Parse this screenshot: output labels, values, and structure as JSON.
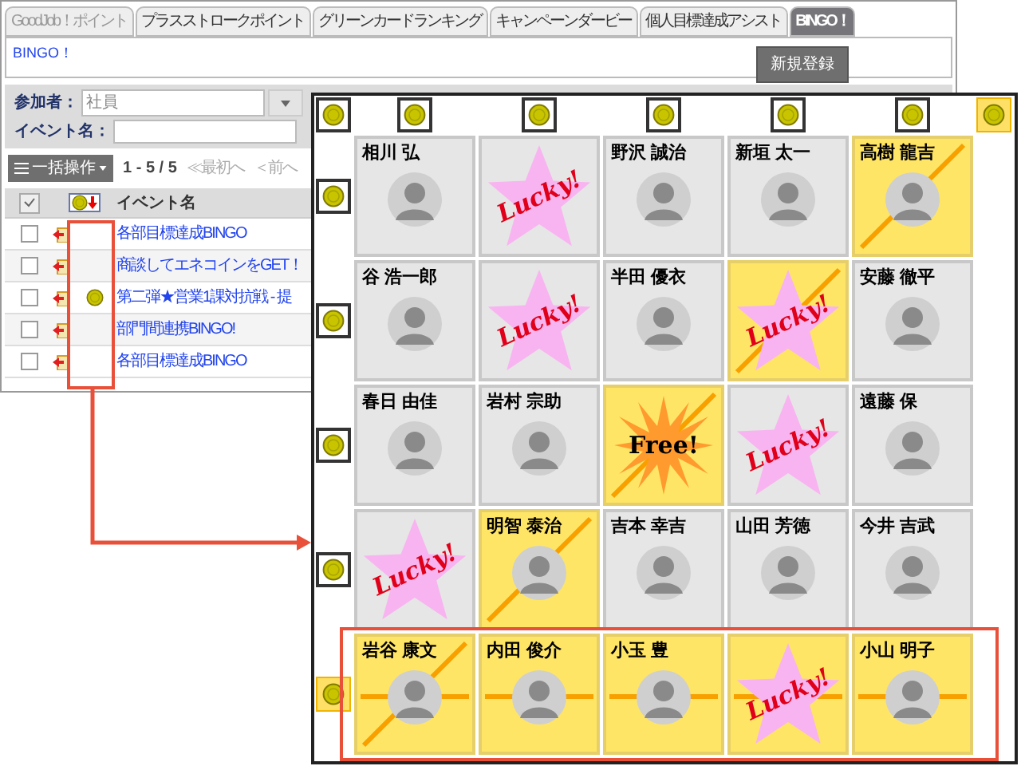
{
  "tabs": [
    {
      "label": "GoodJob！ポイント",
      "selected": false,
      "disabled": true
    },
    {
      "label": "プラスストロークポイント",
      "selected": false,
      "disabled": false
    },
    {
      "label": "グリーンカードランキング",
      "selected": false,
      "disabled": false
    },
    {
      "label": "キャンペーンダービー",
      "selected": false,
      "disabled": false
    },
    {
      "label": "個人目標達成アシスト",
      "selected": false,
      "disabled": false
    },
    {
      "label": "BINGO！",
      "selected": true,
      "disabled": false
    }
  ],
  "page_title": "BINGO！",
  "new_button": "新規登録",
  "filters": {
    "participant_label": "参加者：",
    "participant_value": "社員",
    "event_label": "イベント名："
  },
  "toolbar": {
    "bulk_button": "一括操作",
    "range": "1 - 5 / 5",
    "first": "≪最初へ",
    "prev": "＜前へ"
  },
  "table": {
    "column_title": "イベント名",
    "rows": [
      {
        "checked": false,
        "has_coin": false,
        "title": "各部目標達成BINGO"
      },
      {
        "checked": false,
        "has_coin": false,
        "title": "商談してエネコインをGET！"
      },
      {
        "checked": false,
        "has_coin": true,
        "title": "第二弾★営業1課対抗戦 - 提"
      },
      {
        "checked": false,
        "has_coin": false,
        "title": "部門間連携BINGO!"
      },
      {
        "checked": false,
        "has_coin": false,
        "title": "各部目標達成BINGO"
      }
    ]
  },
  "board": {
    "diagonal_markers": [
      {
        "selected": false
      },
      {
        "selected": true
      }
    ],
    "column_markers": [
      {
        "selected": false
      },
      {
        "selected": false
      },
      {
        "selected": false
      },
      {
        "selected": false
      },
      {
        "selected": false
      }
    ],
    "row_markers": [
      {
        "selected": false
      },
      {
        "selected": false
      },
      {
        "selected": false
      },
      {
        "selected": false
      },
      {
        "selected": true
      }
    ],
    "rows": [
      {
        "cells": [
          {
            "kind": "person",
            "name": "相川 弘",
            "marked": false,
            "diagonal_strike": false,
            "horizontal_strike": false
          },
          {
            "kind": "lucky",
            "label": "Lucky!",
            "marked": false,
            "diagonal_strike": false,
            "horizontal_strike": false
          },
          {
            "kind": "person",
            "name": "野沢 誠治",
            "marked": false,
            "diagonal_strike": false,
            "horizontal_strike": false
          },
          {
            "kind": "person",
            "name": "新垣 太一",
            "marked": false,
            "diagonal_strike": false,
            "horizontal_strike": false
          },
          {
            "kind": "person",
            "name": "高樹 龍吉",
            "marked": true,
            "diagonal_strike": true,
            "horizontal_strike": false
          }
        ]
      },
      {
        "cells": [
          {
            "kind": "person",
            "name": "谷 浩一郎",
            "marked": false,
            "diagonal_strike": false,
            "horizontal_strike": false
          },
          {
            "kind": "lucky",
            "label": "Lucky!",
            "marked": false,
            "diagonal_strike": false,
            "horizontal_strike": false
          },
          {
            "kind": "person",
            "name": "半田 優衣",
            "marked": false,
            "diagonal_strike": false,
            "horizontal_strike": false
          },
          {
            "kind": "lucky",
            "label": "Lucky!",
            "marked": true,
            "diagonal_strike": true,
            "horizontal_strike": false
          },
          {
            "kind": "person",
            "name": "安藤 徹平",
            "marked": false,
            "diagonal_strike": false,
            "horizontal_strike": false
          }
        ]
      },
      {
        "cells": [
          {
            "kind": "person",
            "name": "春日 由佳",
            "marked": false,
            "diagonal_strike": false,
            "horizontal_strike": false
          },
          {
            "kind": "person",
            "name": "岩村 宗助",
            "marked": false,
            "diagonal_strike": false,
            "horizontal_strike": false
          },
          {
            "kind": "free",
            "label": "Free!",
            "marked": true,
            "diagonal_strike": true,
            "horizontal_strike": false
          },
          {
            "kind": "lucky",
            "label": "Lucky!",
            "marked": false,
            "diagonal_strike": false,
            "horizontal_strike": false
          },
          {
            "kind": "person",
            "name": "遠藤 保",
            "marked": false,
            "diagonal_strike": false,
            "horizontal_strike": false
          }
        ]
      },
      {
        "cells": [
          {
            "kind": "lucky",
            "label": "Lucky!",
            "marked": false,
            "diagonal_strike": false,
            "horizontal_strike": false
          },
          {
            "kind": "person",
            "name": "明智 泰治",
            "marked": true,
            "diagonal_strike": true,
            "horizontal_strike": false
          },
          {
            "kind": "person",
            "name": "吉本 幸吉",
            "marked": false,
            "diagonal_strike": false,
            "horizontal_strike": false
          },
          {
            "kind": "person",
            "name": "山田 芳徳",
            "marked": false,
            "diagonal_strike": false,
            "horizontal_strike": false
          },
          {
            "kind": "person",
            "name": "今井 吉武",
            "marked": false,
            "diagonal_strike": false,
            "horizontal_strike": false
          }
        ]
      },
      {
        "cells": [
          {
            "kind": "person",
            "name": "岩谷 康文",
            "marked": true,
            "diagonal_strike": true,
            "horizontal_strike": true
          },
          {
            "kind": "person",
            "name": "内田 俊介",
            "marked": true,
            "diagonal_strike": false,
            "horizontal_strike": true
          },
          {
            "kind": "person",
            "name": "小玉 豊",
            "marked": true,
            "diagonal_strike": false,
            "horizontal_strike": true
          },
          {
            "kind": "lucky",
            "label": "Lucky!",
            "marked": true,
            "diagonal_strike": false,
            "horizontal_strike": true
          },
          {
            "kind": "person",
            "name": "小山 明子",
            "marked": true,
            "diagonal_strike": false,
            "horizontal_strike": true
          }
        ]
      }
    ]
  }
}
